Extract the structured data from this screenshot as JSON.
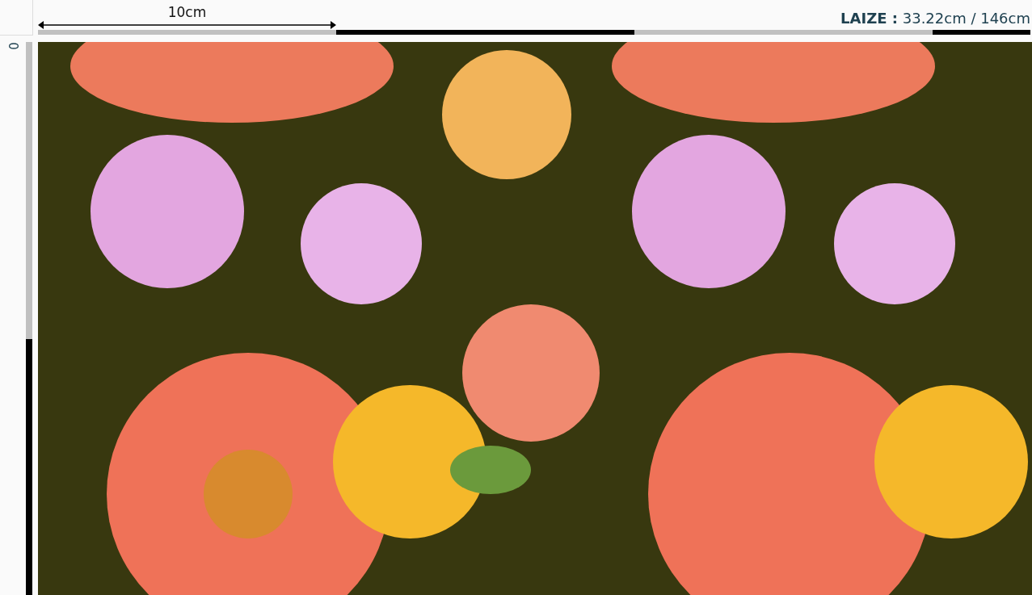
{
  "ruler": {
    "measure_label": "10cm",
    "origin_label": "0"
  },
  "fabric_width": {
    "label": "LAIZE :",
    "value": "33.22cm / 146cm"
  }
}
